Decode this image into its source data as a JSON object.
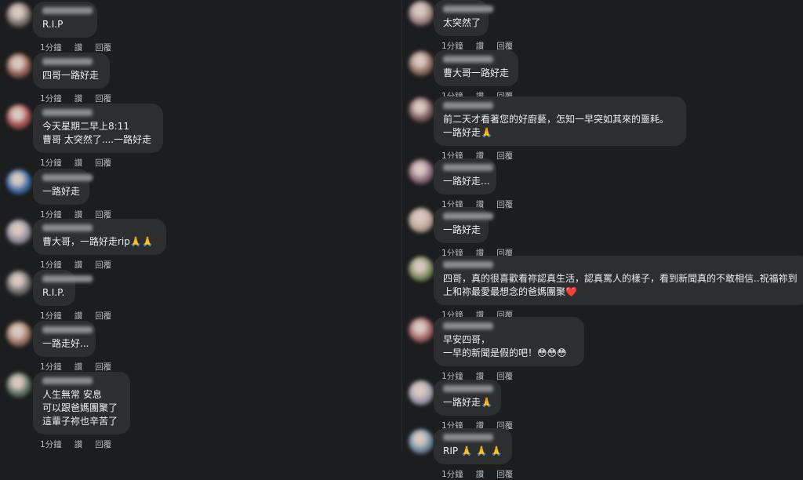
{
  "actions": {
    "time": "1分鐘",
    "like": "讚",
    "reply": "回覆"
  },
  "left_comments": [
    {
      "lines": [
        "R.I.P"
      ],
      "avatar": "#7a6e6a"
    },
    {
      "lines": [
        "四哥一路好走"
      ],
      "avatar": "#8a5a4a"
    },
    {
      "lines": [
        "今天星期二早上8:11",
        "曹哥 太突然了....一路好走"
      ],
      "avatar": "#a34a4a"
    },
    {
      "lines": [
        "一路好走"
      ],
      "avatar": "#3a6aa8"
    },
    {
      "lines": [
        "曹大哥，一路好走rip🙏🙏"
      ],
      "avatar": "#8c8a9a"
    },
    {
      "lines": [
        "R.I.P."
      ],
      "avatar": "#6a6a6a"
    },
    {
      "lines": [
        "一路走好..."
      ],
      "avatar": "#9a7060"
    },
    {
      "lines": [
        "人生無常 安息",
        "可以跟爸媽團聚了",
        "這輩子祢也辛苦了"
      ],
      "avatar": "#5a7060"
    }
  ],
  "right_comments": [
    {
      "lines": [
        "太突然了"
      ],
      "avatar": "#9a8080"
    },
    {
      "lines": [
        "曹大哥一路好走"
      ],
      "avatar": "#8a6a5a"
    },
    {
      "lines": [
        "前二天才看著您的好廚藝，怎知一早突如其來的噩耗。",
        "一路好走🙏"
      ],
      "avatar": "#7a5a5a"
    },
    {
      "lines": [
        "一路好走..."
      ],
      "avatar": "#8a6a7a"
    },
    {
      "lines": [
        "一路好走"
      ],
      "avatar": "#b8a090"
    },
    {
      "lines": [
        "四哥，真的很喜歡看祢認真生活，認真罵人的樣子，看到新聞真的不敢相信..祝福祢到",
        "上和祢最愛最想念的爸媽團聚❤️"
      ],
      "avatar": "#7a8a5a"
    },
    {
      "lines": [
        "早安四哥，",
        "一早的新聞是假的吧！😳😳😳"
      ],
      "avatar": "#a06060"
    },
    {
      "lines": [
        "一路好走🙏"
      ],
      "avatar": "#9a9aaa"
    },
    {
      "lines": [
        "RIP 🙏 🙏 🙏"
      ],
      "avatar": "#6a8aa0"
    }
  ]
}
